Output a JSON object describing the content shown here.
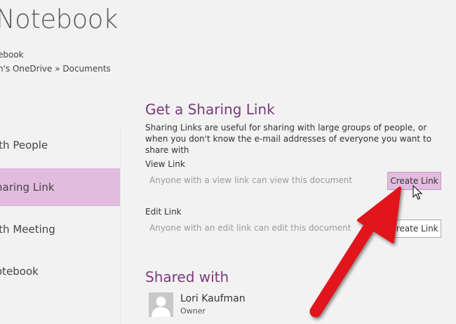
{
  "header": {
    "title": "Notebook",
    "location_line1": "ebook",
    "location_line2": "n's OneDrive » Documents"
  },
  "nav": {
    "items": [
      {
        "label": "ith People"
      },
      {
        "label": "haring Link"
      },
      {
        "label": "ith Meeting"
      },
      {
        "label": "otebook"
      }
    ]
  },
  "sharing": {
    "title": "Get a Sharing Link",
    "description": "Sharing Links are useful for sharing with large groups of people, or when you don't know the e-mail addresses of everyone you want to share with",
    "view_label": "View Link",
    "view_placeholder": "Anyone with a view link can view this document",
    "view_button": "Create Link",
    "edit_label": "Edit Link",
    "edit_placeholder": "Anyone with an edit link can edit this document",
    "edit_button": "Create Link"
  },
  "shared_with": {
    "title": "Shared with",
    "user_name": "Lori Kaufman",
    "user_role": "Owner"
  },
  "colors": {
    "accent": "#7a3a7a",
    "selected_bg": "#e2bcde",
    "arrow": "#e0121b"
  }
}
